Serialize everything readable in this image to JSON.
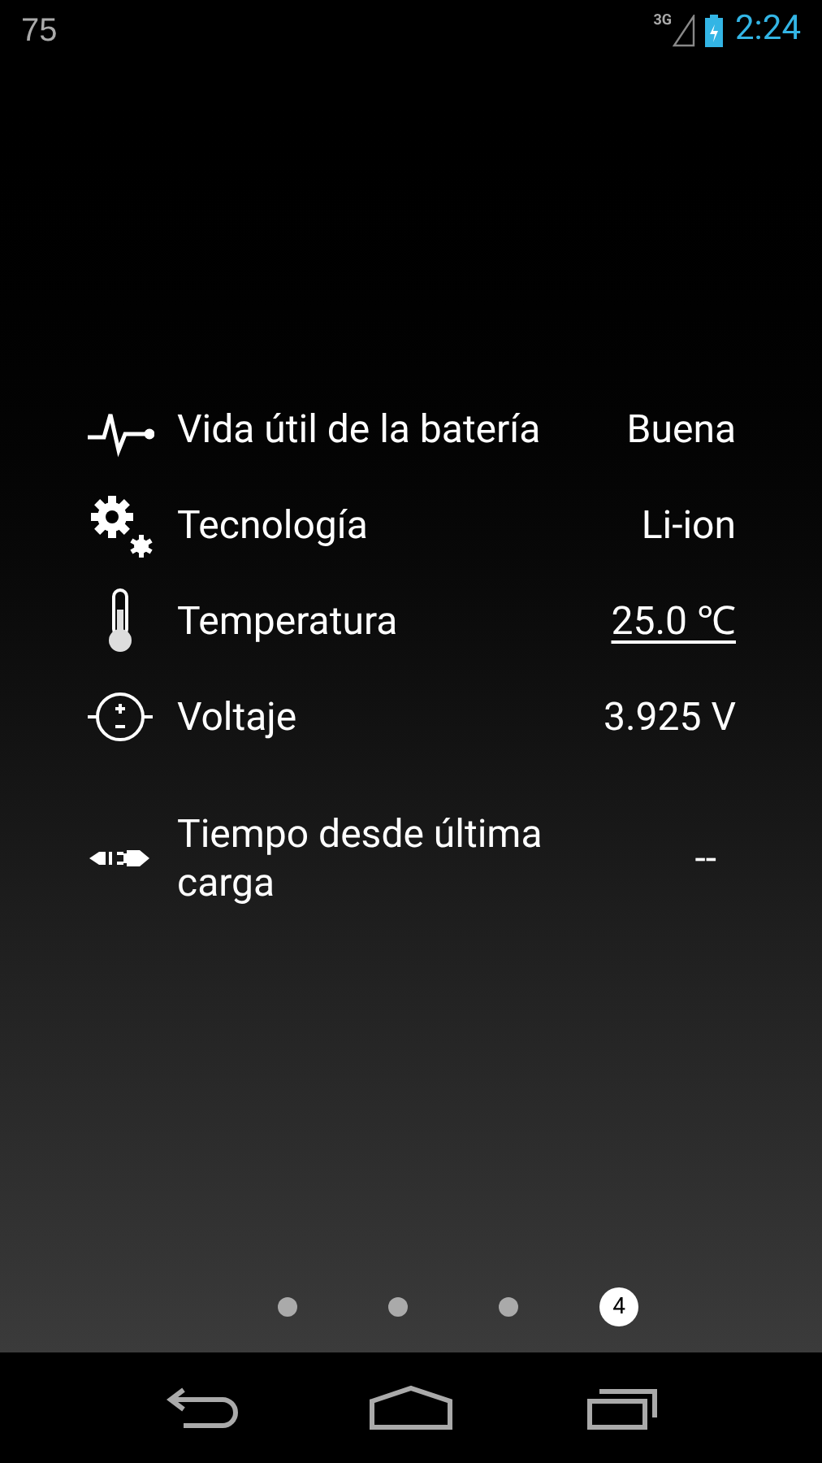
{
  "status_bar": {
    "left_text": "75",
    "network": "3G",
    "time": "2:24"
  },
  "rows": [
    {
      "kind": "health",
      "label": "Vida útil de la batería",
      "value": "Buena",
      "underlined": false
    },
    {
      "kind": "technology",
      "label": "Tecnología",
      "value": "Li-ion",
      "underlined": false
    },
    {
      "kind": "temperature",
      "label": "Temperatura",
      "value": "25.0 ℃",
      "underlined": true
    },
    {
      "kind": "voltage",
      "label": "Voltaje",
      "value": "3.925 V",
      "underlined": false
    },
    {
      "kind": "plug",
      "label": "Tiempo desde última carga",
      "value": "--",
      "underlined": false
    }
  ],
  "pager": [
    {
      "selected": false
    },
    {
      "selected": false
    },
    {
      "selected": false
    },
    {
      "selected": true,
      "label": "4"
    }
  ]
}
